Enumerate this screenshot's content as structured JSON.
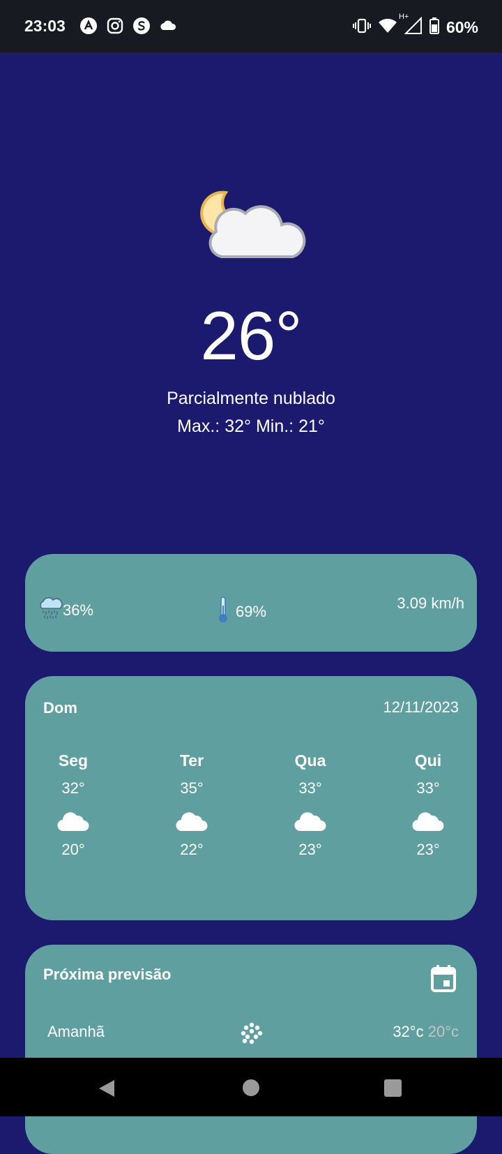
{
  "status_bar": {
    "time": "23:03",
    "left_icons": [
      "app-a-icon",
      "instagram-icon",
      "app-s-icon",
      "cloud-icon"
    ],
    "network_label": "H+",
    "battery": "60%"
  },
  "current": {
    "icon": "partly-cloudy-night-icon",
    "temperature": "26°",
    "description": "Parcialmente nublado",
    "max_min": "Max.: 32° Min.: 21°"
  },
  "stats": {
    "rain": "36%",
    "humidity": "69%",
    "wind": "3.09 km/h"
  },
  "week": {
    "today": "Dom",
    "date": "12/11/2023",
    "days": [
      {
        "name": "Seg",
        "max": "32°",
        "min": "20°",
        "icon": "cloud-icon"
      },
      {
        "name": "Ter",
        "max": "35°",
        "min": "22°",
        "icon": "cloud-icon"
      },
      {
        "name": "Qua",
        "max": "33°",
        "min": "23°",
        "icon": "cloud-icon"
      },
      {
        "name": "Qui",
        "max": "33°",
        "min": "23°",
        "icon": "cloud-icon"
      }
    ]
  },
  "next_forecast": {
    "title": "Próxima previsão",
    "rows": [
      {
        "day": "Amanhã",
        "max": "32°c",
        "min": "20°c",
        "icon": "snow-icon"
      }
    ]
  },
  "colors": {
    "background": "#1b1a6f",
    "card": "#5f9f9f",
    "status_bar": "#171a21"
  }
}
